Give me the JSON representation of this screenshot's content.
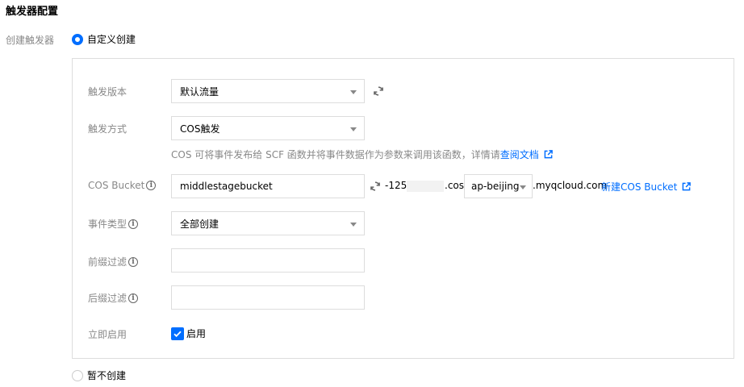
{
  "title": "触发器配置",
  "create_label": "创建触发器",
  "options": {
    "custom": "自定义创建",
    "none": "暂不创建"
  },
  "form": {
    "version": {
      "label": "触发版本",
      "value": "默认流量"
    },
    "method": {
      "label": "触发方式",
      "value": "COS触发",
      "hint": "COS 可将事件发布给 SCF 函数并将事件数据作为参数来调用该函数，详情请",
      "hint_link": "查阅文档"
    },
    "bucket": {
      "label": "COS Bucket",
      "value": "middlestagebucket",
      "appid_prefix": "-125",
      "cos_part": ".cos.",
      "region": "ap-beijing",
      "domain": ".myqcloud.com",
      "new_link": "新建COS Bucket"
    },
    "event": {
      "label": "事件类型",
      "value": "全部创建"
    },
    "prefix": {
      "label": "前缀过滤",
      "value": ""
    },
    "suffix": {
      "label": "后缀过滤",
      "value": ""
    },
    "enable": {
      "label": "立即启用",
      "checkbox_label": "启用",
      "checked": true
    }
  },
  "colors": {
    "accent": "#006eff",
    "label": "#888888",
    "border": "#dddddd"
  }
}
